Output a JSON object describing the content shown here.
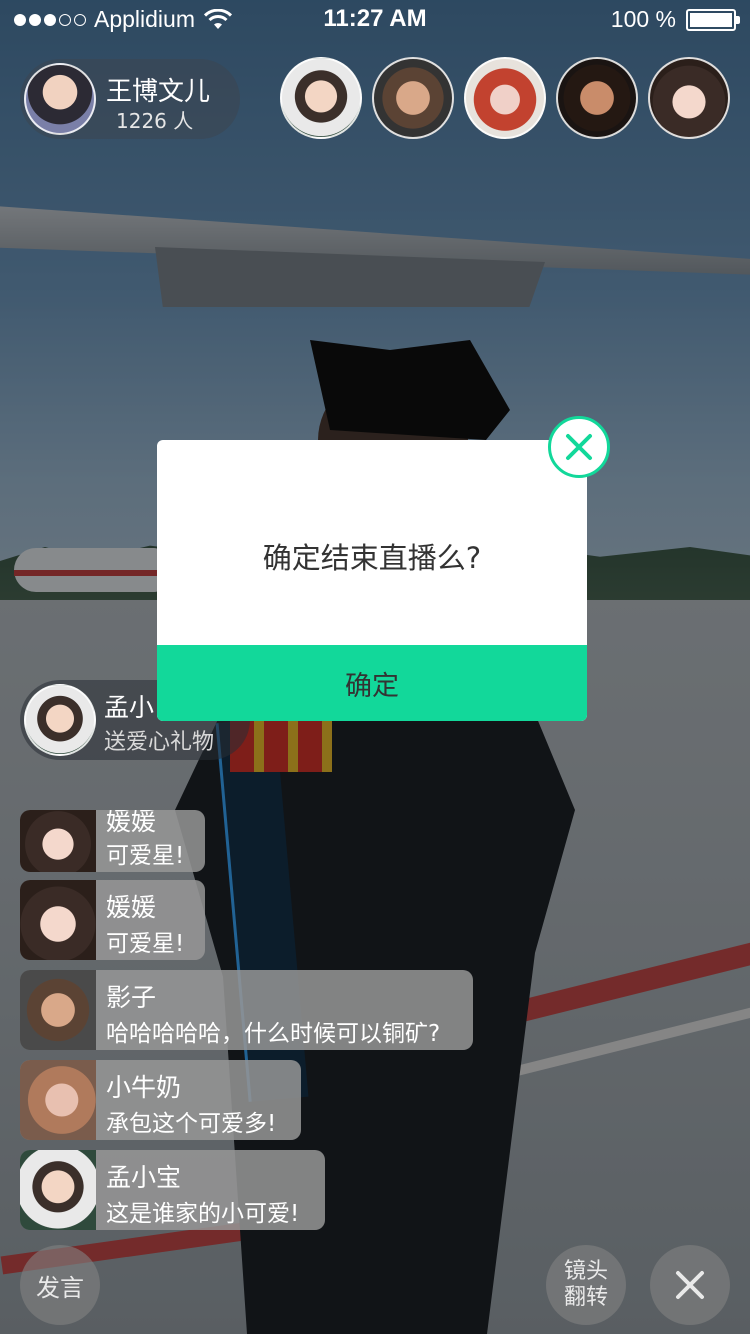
{
  "status_bar": {
    "carrier": "Applidium",
    "time": "11:27 AM",
    "battery": "100 %",
    "signal_icon": "signal-dots-icon",
    "wifi_icon": "wifi-icon",
    "battery_icon": "battery-icon"
  },
  "host": {
    "name": "王博文儿",
    "viewer_count": "1226 人"
  },
  "viewers_count_shown": 5,
  "gift_notice": {
    "name": "孟小",
    "text": "送爱心礼物"
  },
  "chat": [
    {
      "name": "媛媛",
      "message": "可爱星!"
    },
    {
      "name": "媛媛",
      "message": "可爱星!"
    },
    {
      "name": "影子",
      "message": "哈哈哈哈哈，什么时候可以铜矿?"
    },
    {
      "name": "小牛奶",
      "message": "承包这个可爱多!"
    },
    {
      "name": "孟小宝",
      "message": "这是谁家的小可爱!"
    }
  ],
  "controls": {
    "speak_label": "发言",
    "flip_label": "镜头翻转",
    "close_icon": "close-icon"
  },
  "modal": {
    "message": "确定结束直播么?",
    "confirm_label": "确定",
    "accent_color": "#12d89a",
    "close_icon": "close-circle-icon"
  }
}
